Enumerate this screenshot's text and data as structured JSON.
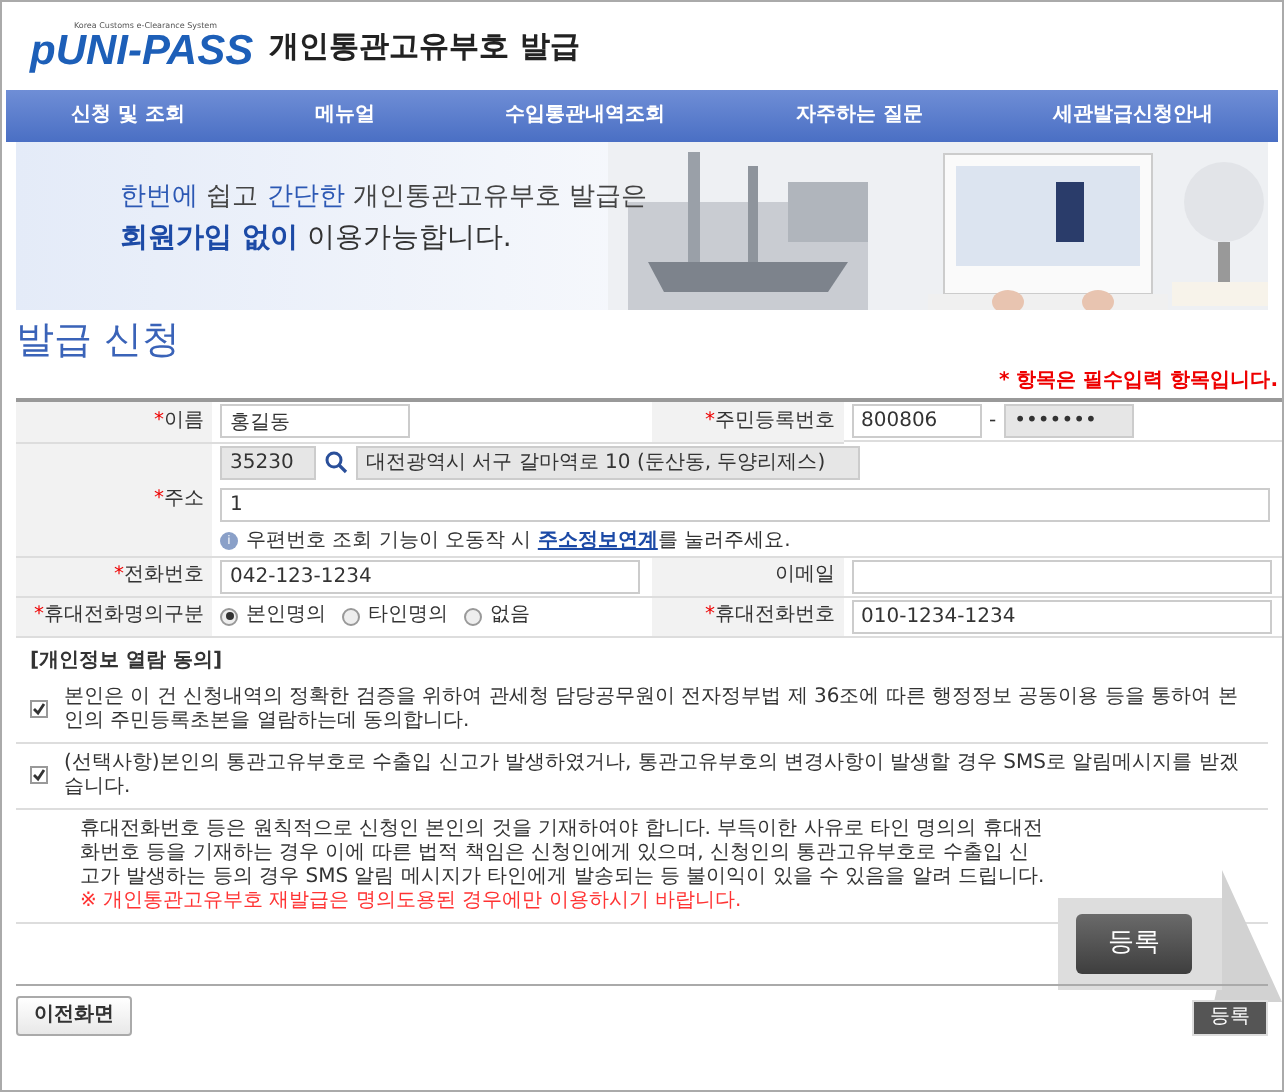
{
  "header": {
    "logo_tagline": "Korea Customs e-Clearance System",
    "logo_letter": "p",
    "logo_word": "UNI-PASS",
    "title": "개인통관고유부호 발급"
  },
  "nav": [
    {
      "label": "신청 및 조회"
    },
    {
      "label": "메뉴얼"
    },
    {
      "label": "수입통관내역조회"
    },
    {
      "label": "자주하는 질문"
    },
    {
      "label": "세관발급신청안내"
    }
  ],
  "banner": {
    "lines": [
      [
        {
          "text": "한번에",
          "highlight": true
        },
        {
          "text": " 쉽고 ",
          "highlight": false
        },
        {
          "text": "간단한",
          "highlight": true
        },
        {
          "text": " 개인통관고유부호 발급은",
          "highlight": false
        }
      ],
      [
        {
          "text": "회원가입 없이",
          "highlight": true
        },
        {
          "text": " 이용가능합니다.",
          "highlight": false
        }
      ]
    ]
  },
  "page_title": "발급 신청",
  "required_note": "* 항목은 필수입력 항목입니다.",
  "form": {
    "name": {
      "required_mark": "*",
      "label": "이름",
      "value": "홍길동"
    },
    "rrn": {
      "required_mark": "*",
      "label": "주민등록번호",
      "front": "800806",
      "separator": "-",
      "back": "•••••••"
    },
    "address": {
      "required_mark": "*",
      "label": "주소",
      "zip": "35230",
      "road": "대전광역시 서구 갈마역로 10 (둔산동, 두양리제스)",
      "detail": "1",
      "hint_icon": "i",
      "hint": "우편번호 조회 기능이 오동작 시 ",
      "hint_link": "주소정보연계",
      "hint_tail": "를 눌러주세요."
    },
    "phone": {
      "required_mark": "*",
      "label": "전화번호",
      "value": "042-123-1234"
    },
    "email": {
      "label": "이메일"
    },
    "mobile_owner": {
      "required_mark": "*",
      "label": "휴대전화명의구분",
      "options": [
        {
          "label": "본인명의",
          "selected": true
        },
        {
          "label": "타인명의",
          "selected": false
        },
        {
          "label": "없음",
          "selected": false
        }
      ]
    },
    "mobile": {
      "required_mark": "*",
      "label": "휴대전화번호",
      "value": "010-1234-1234"
    }
  },
  "consent": {
    "heading": "[개인정보 열람 동의]",
    "items": [
      {
        "text": "본인은 이 건 신청내역의 정확한 검증을 위하여 관세청 담당공무원이 전자정부법 제 36조에 따른 행정정보 공동이용 등을 통하여 본인의 주민등록초본을 열람하는데 동의합니다.",
        "checked": true
      },
      {
        "text": "(선택사항)본인의 통관고유부호로 수출입 신고가 발생하였거나, 통관고유부호의 변경사항이 발생할 경우 SMS로 알림메시지를 받겠습니다.",
        "checked": true
      }
    ]
  },
  "notice": "휴대전화번호 등은 원칙적으로 신청인 본인의 것을 기재하여야 합니다. 부득이한 사유로 타인 명의의 휴대전화번호 등을 기재하는 경우 이에 따른 법적 책임은 신청인에게 있으며, 신청인의 통관고유부호로 수출입 신고가 발생하는 등의 경우 SMS 알림 메시지가 타인에게 발송되는 등 불이익이 있을 수 있음을 알려 드립니다.",
  "warning": "※ 개인통관고유부호 재발급은 명의도용된 경우에만 이용하시기 바랍니다.",
  "callout_button": "등록",
  "back_button": "이전화면",
  "submit_button": "등록"
}
